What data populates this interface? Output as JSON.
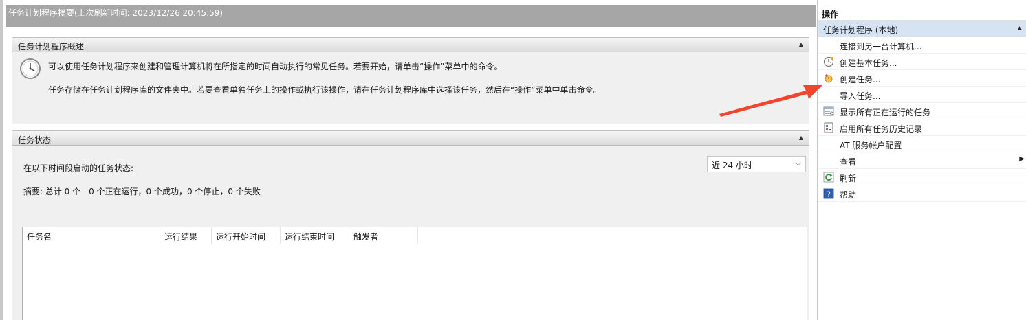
{
  "main": {
    "title": "任务计划程序摘要(上次刷新时间: 2023/12/26 20:45:59)",
    "overview": {
      "header": "任务计划程序概述",
      "line1": "可以使用任务计划程序来创建和管理计算机将在所指定的时间自动执行的常见任务。若要开始，请单击“操作”菜单中的命令。",
      "line2": "任务存储在任务计划程序库的文件夹中。若要查看单独任务上的操作或执行该操作，请在任务计划程序库中选择该任务，然后在“操作”菜单中单击命令。"
    },
    "status": {
      "header": "任务状态",
      "label": "在以下时间段启动的任务状态:",
      "time_range": "近 24 小时",
      "summary": "摘要: 总计 0 个 - 0 个正在运行，0 个成功，0 个停止，0 个失败",
      "columns": [
        "任务名",
        "运行结果",
        "运行开始时间",
        "运行结束时间",
        "触发者"
      ]
    }
  },
  "actions": {
    "title": "操作",
    "group": "任务计划程序 (本地)",
    "items": [
      {
        "label": "连接到另一台计算机...",
        "icon": "none"
      },
      {
        "label": "创建基本任务...",
        "icon": "clock-wizard-icon"
      },
      {
        "label": "创建任务...",
        "icon": "new-task-icon"
      },
      {
        "label": "导入任务...",
        "icon": "none"
      },
      {
        "label": "显示所有正在运行的任务",
        "icon": "running-tasks-icon"
      },
      {
        "label": "启用所有任务历史记录",
        "icon": "history-icon"
      },
      {
        "label": "AT 服务帐户配置",
        "icon": "none"
      },
      {
        "label": "查看",
        "icon": "none"
      },
      {
        "label": "刷新",
        "icon": "refresh-icon"
      },
      {
        "label": "帮助",
        "icon": "help-icon"
      }
    ]
  },
  "colors": {
    "title_bar": "#a6a6a6",
    "group_highlight": "#d5e3f3",
    "annotation_arrow": "#f0462d"
  }
}
